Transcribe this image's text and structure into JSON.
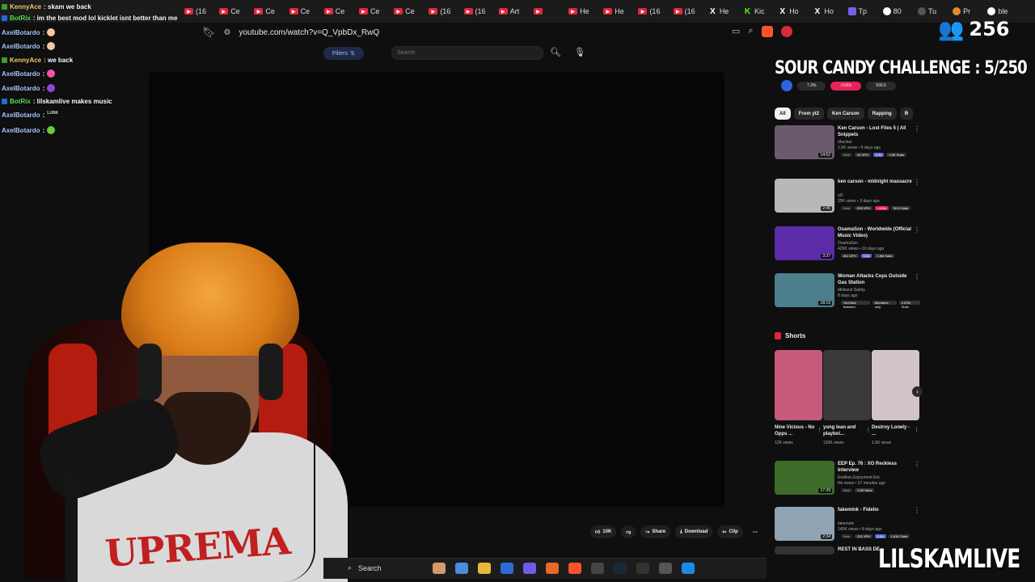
{
  "browser": {
    "tabs": [
      {
        "label": "(16",
        "icon": "youtube-icon"
      },
      {
        "label": "Ce",
        "icon": "youtube-icon"
      },
      {
        "label": "Ce",
        "icon": "youtube-icon"
      },
      {
        "label": "Ce",
        "icon": "youtube-icon"
      },
      {
        "label": "Ce",
        "icon": "youtube-icon"
      },
      {
        "label": "Ce",
        "icon": "youtube-icon"
      },
      {
        "label": "Ce",
        "icon": "youtube-icon"
      },
      {
        "label": "(16",
        "icon": "youtube-icon"
      },
      {
        "label": "(16",
        "icon": "youtube-icon"
      },
      {
        "label": "Art",
        "icon": "youtube-icon"
      },
      {
        "label": "",
        "icon": "youtube-icon"
      },
      {
        "label": "He",
        "icon": "youtube-icon"
      },
      {
        "label": "He",
        "icon": "youtube-icon"
      },
      {
        "label": "(16",
        "icon": "youtube-icon"
      },
      {
        "label": "(16",
        "icon": "youtube-icon"
      },
      {
        "label": "He",
        "icon": "x-icon"
      },
      {
        "label": "Kic",
        "icon": "kick-icon"
      },
      {
        "label": "Ho",
        "icon": "x-icon"
      },
      {
        "label": "Ho",
        "icon": "x-icon"
      },
      {
        "label": "Tp",
        "icon": "twitch-icon"
      },
      {
        "label": "80",
        "icon": "globe-icon"
      },
      {
        "label": "Tu",
        "icon": "puzzle-icon"
      },
      {
        "label": "Pr",
        "icon": "orange-icon"
      },
      {
        "label": "ble",
        "icon": "globe-icon"
      }
    ],
    "url": "youtube.com/watch?v=Q_VpbDx_RwQ"
  },
  "stream": {
    "viewer_count": "256",
    "challenge_text": "SOUR CANDY CHALLENGE : 5/250",
    "brand": "LILSKAMLIVE",
    "shirt_text": "UPREMA",
    "shirt_sub": "REST IN BASS DE"
  },
  "chat": [
    {
      "user": "KennyAce",
      "msg": ": skam we back",
      "badge": "g",
      "emote": ""
    },
    {
      "user": "BotRix",
      "msg": ": im the best mod lol kicklet isnt better than me",
      "badge": "b",
      "emote": ""
    },
    {
      "user": "AxelBotardo",
      "msg": ":",
      "badge": "",
      "emote": "em-hand"
    },
    {
      "user": "AxelBotardo",
      "msg": ":",
      "badge": "",
      "emote": "em-hand"
    },
    {
      "user": "KennyAce",
      "msg": ": we back",
      "badge": "g",
      "emote": ""
    },
    {
      "user": "AxelBotardo",
      "msg": ":",
      "badge": "",
      "emote": "em-heart"
    },
    {
      "user": "AxelBotardo",
      "msg": ":",
      "badge": "",
      "emote": "em-heart2"
    },
    {
      "user": "BotRix",
      "msg": ": lilskamlive makes music",
      "badge": "b",
      "emote": ""
    },
    {
      "user": "AxelBotardo",
      "msg": ":",
      "badge": "",
      "emote": "em-text"
    },
    {
      "user": "AxelBotardo",
      "msg": ":",
      "badge": "",
      "emote": "em-frog"
    }
  ],
  "youtube": {
    "filters_label": "Filters",
    "search_placeholder": "Search",
    "stats": [
      "7.3%",
      ">100x",
      "930.0"
    ],
    "chips": [
      "All",
      "From yt2",
      "Ken Carson",
      "Rapping",
      "R"
    ],
    "recommendations": [
      {
        "title": "Ken Carson - Lost Files 5 | All Snippets",
        "channel": "dhacker",
        "views": "1.5K views • 6 days ago",
        "duration": "14:52",
        "tags": [
          "New",
          "20 VPH",
          "0.3x",
          "3.5K Subs"
        ],
        "thumb": "#6b5a6e"
      },
      {
        "title": "ken carson - midnight massacre",
        "channel": "yt2",
        "views": "35K views • 3 days ago",
        "duration": "2:45",
        "tags": [
          "New",
          "209 VPH",
          ">100x",
          "30.0 Subs"
        ],
        "thumb": "#b8b8b8"
      },
      {
        "title": "OsamaSon - Worldwide (Official Music Video)",
        "channel": "OsamaSon",
        "views": "429K views • 10 days ago",
        "duration": "3:37",
        "tags": [
          "811 VPH",
          "0.3x",
          "1.5M Subs"
        ],
        "thumb": "#5b2ba8"
      },
      {
        "title": "Woman Attacks Cops Outside Gas Station",
        "channel": "Midwest Safety",
        "views": "8 days ago",
        "duration": "18:19",
        "tags": [
          "YouTube featured",
          "Members only",
          "2.07M Subs"
        ],
        "thumb": "#4c7e8c"
      },
      {
        "title": "EEP Ep. 76 : XO Reckless Interview",
        "channel": "Endless Enjoyment Ent.",
        "views": "No views • 37 minutes ago",
        "duration": "17:39",
        "tags": [
          "New",
          "1.5K Subs"
        ],
        "thumb": "#3c6b2a"
      },
      {
        "title": "fakemink - Fidelio",
        "channel": "fakemink",
        "views": "145K views • 8 days ago",
        "duration": "2:34",
        "tags": [
          "New",
          "231 VPH",
          "0.8x",
          "1.61K Subs"
        ],
        "thumb": "#8fa3b5"
      },
      {
        "title": "REST IN BASS DE",
        "channel": "",
        "views": "",
        "duration": "",
        "tags": [],
        "thumb": "#333333"
      }
    ],
    "shorts_label": "Shorts",
    "shorts": [
      {
        "title": "Nine Vicious - No Opps ...",
        "views": "12K views",
        "thumb": "#c75a7a"
      },
      {
        "title": "yung lean and playboi...",
        "views": "120K views",
        "thumb": "#3a3a3a"
      },
      {
        "title": "Destroy Lonely - ...",
        "views": "1.6K views",
        "thumb": "#d3c4c9"
      }
    ],
    "actions": {
      "like": "10K",
      "dislike": "",
      "share": "Share",
      "download": "Download",
      "clip": "Clip"
    }
  },
  "taskbar": {
    "search_label": "Search",
    "icons": [
      "widgets-icon",
      "copilot-icon",
      "files-icon",
      "store-icon",
      "discord-icon",
      "app-icon",
      "brave-icon",
      "obs-icon",
      "steam-icon",
      "nvidia-icon",
      "4k-icon",
      "app2-icon"
    ]
  }
}
